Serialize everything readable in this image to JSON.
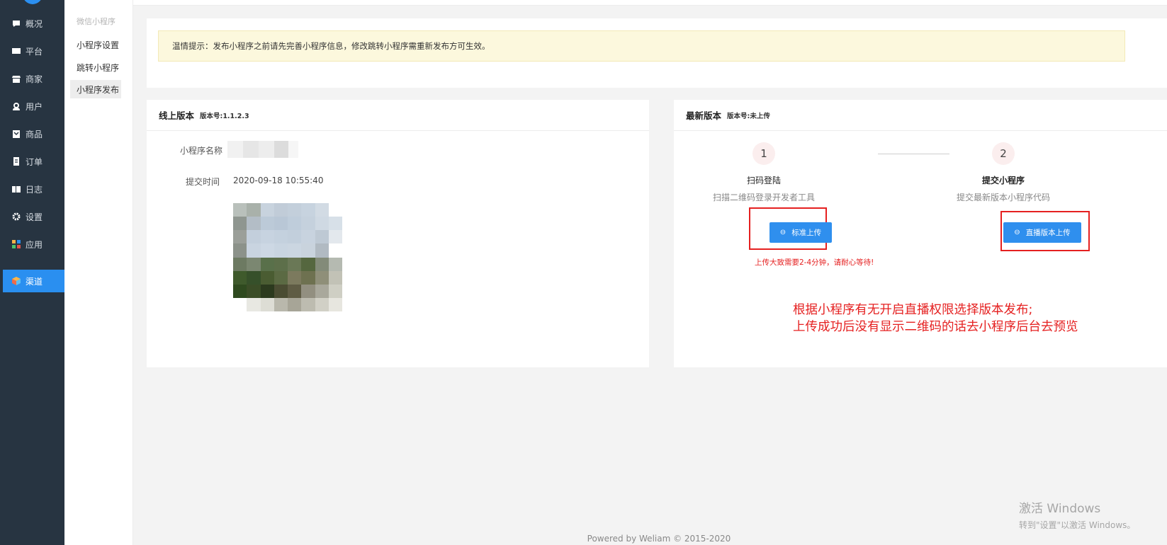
{
  "nav": {
    "items": [
      {
        "label": "概况",
        "icon": "chat-bubble-icon"
      },
      {
        "label": "平台",
        "icon": "monitor-icon"
      },
      {
        "label": "商家",
        "icon": "store-icon"
      },
      {
        "label": "用户",
        "icon": "user-icon"
      },
      {
        "label": "商品",
        "icon": "goods-icon"
      },
      {
        "label": "订单",
        "icon": "order-icon"
      },
      {
        "label": "日志",
        "icon": "log-icon"
      },
      {
        "label": "设置",
        "icon": "gear-icon"
      },
      {
        "label": "应用",
        "icon": "apps-grid-icon"
      },
      {
        "label": "渠道",
        "icon": "channel-cube-icon",
        "active": true
      }
    ]
  },
  "subnav": {
    "title": "微信小程序",
    "items": [
      {
        "label": "小程序设置"
      },
      {
        "label": "跳转小程序"
      },
      {
        "label": "小程序发布",
        "active": true
      }
    ]
  },
  "notice": {
    "text": "温情提示：发布小程序之前请先完善小程序信息，修改跳转小程序需重新发布方可生效。"
  },
  "online": {
    "title": "线上版本",
    "version": "版本号:1.1.2.3",
    "name_label": "小程序名称",
    "time_label": "提交时间",
    "time_value": "2020-09-18 10:55:40"
  },
  "latest": {
    "title": "最新版本",
    "version": "版本号:未上传",
    "step1": {
      "num": "1",
      "name": "扫码登陆",
      "desc": "扫描二维码登录开发者工具"
    },
    "step2": {
      "num": "2",
      "name": "提交小程序",
      "desc": "提交最新版本小程序代码"
    },
    "btn_standard": "标准上传",
    "btn_live": "直播版本上传",
    "warning": "上传大致需要2-4分钟，请耐心等待!",
    "note_line1": "根据小程序有无开启直播权限选择版本发布;",
    "note_line2": "上传成功后没有显示二维码的话去小程序后台去预览"
  },
  "footer": "Powered by Weliam © 2015-2020",
  "watermark": {
    "line1": "激活 Windows",
    "line2": "转到\"设置\"以激活 Windows。"
  },
  "colors": {
    "accent": "#2f8fee",
    "sidebar": "#273441",
    "warning_red": "#e52020",
    "notice_bg": "#fcf8dd"
  }
}
